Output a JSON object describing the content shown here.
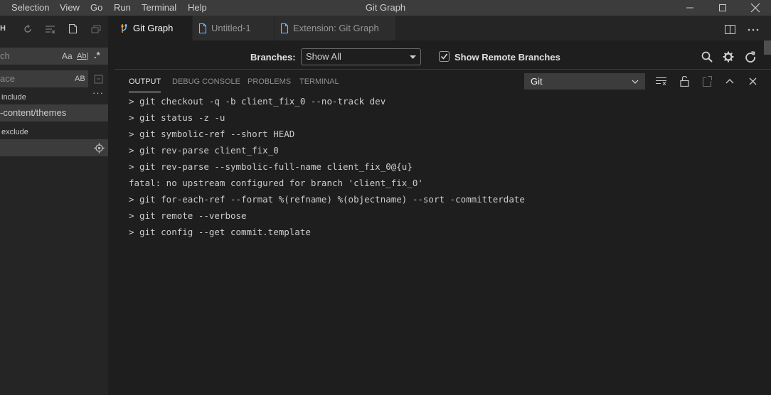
{
  "titlebar": {
    "menus": [
      "Selection",
      "View",
      "Go",
      "Run",
      "Terminal",
      "Help"
    ],
    "title": "Git Graph"
  },
  "sidebar": {
    "header_text": "H",
    "search": {
      "value_fragment": "ch",
      "opt_case": "Aa",
      "opt_word": "Ab|",
      "opt_regex": ".*"
    },
    "replace": {
      "placeholder_fragment": "ace",
      "opt_preserve": "AB"
    },
    "include": {
      "label": "include",
      "value": "-content/themes"
    },
    "exclude": {
      "label": "exclude",
      "value": ""
    },
    "more": "···"
  },
  "tabs": [
    {
      "label": "Git Graph",
      "active": true
    },
    {
      "label": "Untitled-1",
      "active": false
    },
    {
      "label": "Extension: Git Graph",
      "active": false
    }
  ],
  "gitgraph": {
    "branches_label": "Branches:",
    "branches_value": "Show All",
    "remote_label": "Show Remote Branches",
    "remote_checked": true
  },
  "panel": {
    "tabs": [
      "OUTPUT",
      "DEBUG CONSOLE",
      "PROBLEMS",
      "TERMINAL"
    ],
    "active_tab": "OUTPUT",
    "channel": "Git",
    "lines": [
      "> git checkout -q -b client_fix_0 --no-track dev",
      "> git status -z -u",
      "> git symbolic-ref --short HEAD",
      "> git rev-parse client_fix_0",
      "> git rev-parse --symbolic-full-name client_fix_0@{u}",
      "fatal: no upstream configured for branch 'client_fix_0'",
      "> git for-each-ref --format %(refname) %(objectname) --sort -committerdate",
      "> git remote --verbose",
      "> git config --get commit.template"
    ]
  },
  "colors": {
    "titlebar": "#3c3c3c",
    "sidebar": "#252526",
    "editor": "#1e1e1e",
    "input": "#3c3c3c",
    "tab_icon_blue": "#75beff",
    "git_icon_orange": "#f14c4c"
  }
}
